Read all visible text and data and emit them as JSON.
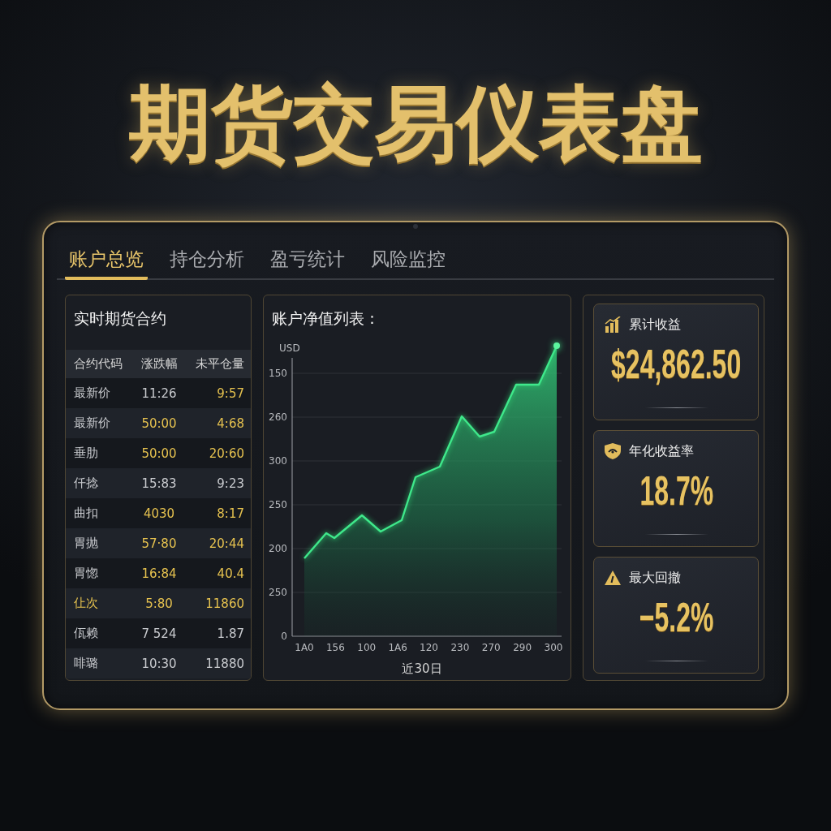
{
  "title": "期货交易仪表盘",
  "tabs": [
    {
      "label": "账户总览",
      "selected": true
    },
    {
      "label": "持仓分析",
      "selected": false
    },
    {
      "label": "盈亏统计",
      "selected": false
    },
    {
      "label": "风险监控",
      "selected": false
    }
  ],
  "contracts_panel": {
    "title": "实时期货合约",
    "columns": [
      "合约代码",
      "涨跌幅",
      "未平仓量"
    ],
    "rows": [
      {
        "cells": [
          {
            "text": "最新价",
            "highlight": false
          },
          {
            "text": "11:26",
            "highlight": false
          },
          {
            "text": "9:57",
            "highlight": true
          }
        ]
      },
      {
        "cells": [
          {
            "text": "最新价",
            "highlight": false
          },
          {
            "text": "50:00",
            "highlight": true
          },
          {
            "text": "4:68",
            "highlight": true
          }
        ]
      },
      {
        "cells": [
          {
            "text": "垂肋",
            "highlight": false
          },
          {
            "text": "50:00",
            "highlight": true
          },
          {
            "text": "20:60",
            "highlight": true
          }
        ]
      },
      {
        "cells": [
          {
            "text": "仟捻",
            "highlight": false
          },
          {
            "text": "15:83",
            "highlight": false
          },
          {
            "text": "9:23",
            "highlight": false
          }
        ]
      },
      {
        "cells": [
          {
            "text": "曲扣",
            "highlight": false
          },
          {
            "text": "4030",
            "highlight": true
          },
          {
            "text": "8:17",
            "highlight": true
          }
        ]
      },
      {
        "cells": [
          {
            "text": "胃抛",
            "highlight": false
          },
          {
            "text": "57·80",
            "highlight": true
          },
          {
            "text": "20:44",
            "highlight": true
          }
        ]
      },
      {
        "cells": [
          {
            "text": "胃惚",
            "highlight": false
          },
          {
            "text": "16:84",
            "highlight": true
          },
          {
            "text": "40.4",
            "highlight": true
          }
        ]
      },
      {
        "cells": [
          {
            "text": "仩次",
            "highlight": true
          },
          {
            "text": "5:80",
            "highlight": true
          },
          {
            "text": "11860",
            "highlight": true
          }
        ]
      },
      {
        "cells": [
          {
            "text": "佤赖",
            "highlight": false
          },
          {
            "text": "7 524",
            "highlight": false
          },
          {
            "text": "1.87",
            "highlight": false
          }
        ]
      },
      {
        "cells": [
          {
            "text": "啡璐",
            "highlight": false
          },
          {
            "text": "10:30",
            "highlight": false
          },
          {
            "text": "11880",
            "highlight": false
          }
        ]
      }
    ]
  },
  "chart_panel": {
    "title": "账户净值列表：",
    "unit_label": "USD",
    "y_axis_labels": [
      "150",
      "260",
      "300",
      "250",
      "200",
      "250",
      "0"
    ],
    "x_axis_labels": [
      "1A0",
      "156",
      "100",
      "1A6",
      "120",
      "230",
      "270",
      "290",
      "300"
    ],
    "x_axis_title": "近30日"
  },
  "metrics": [
    {
      "kind": "chart",
      "label": "累计收益",
      "value": "$24,862.50"
    },
    {
      "kind": "shield",
      "label": "年化收益率",
      "value": "18.7%"
    },
    {
      "kind": "warning",
      "label": "最大回撤",
      "value": "−5.2%"
    }
  ]
}
